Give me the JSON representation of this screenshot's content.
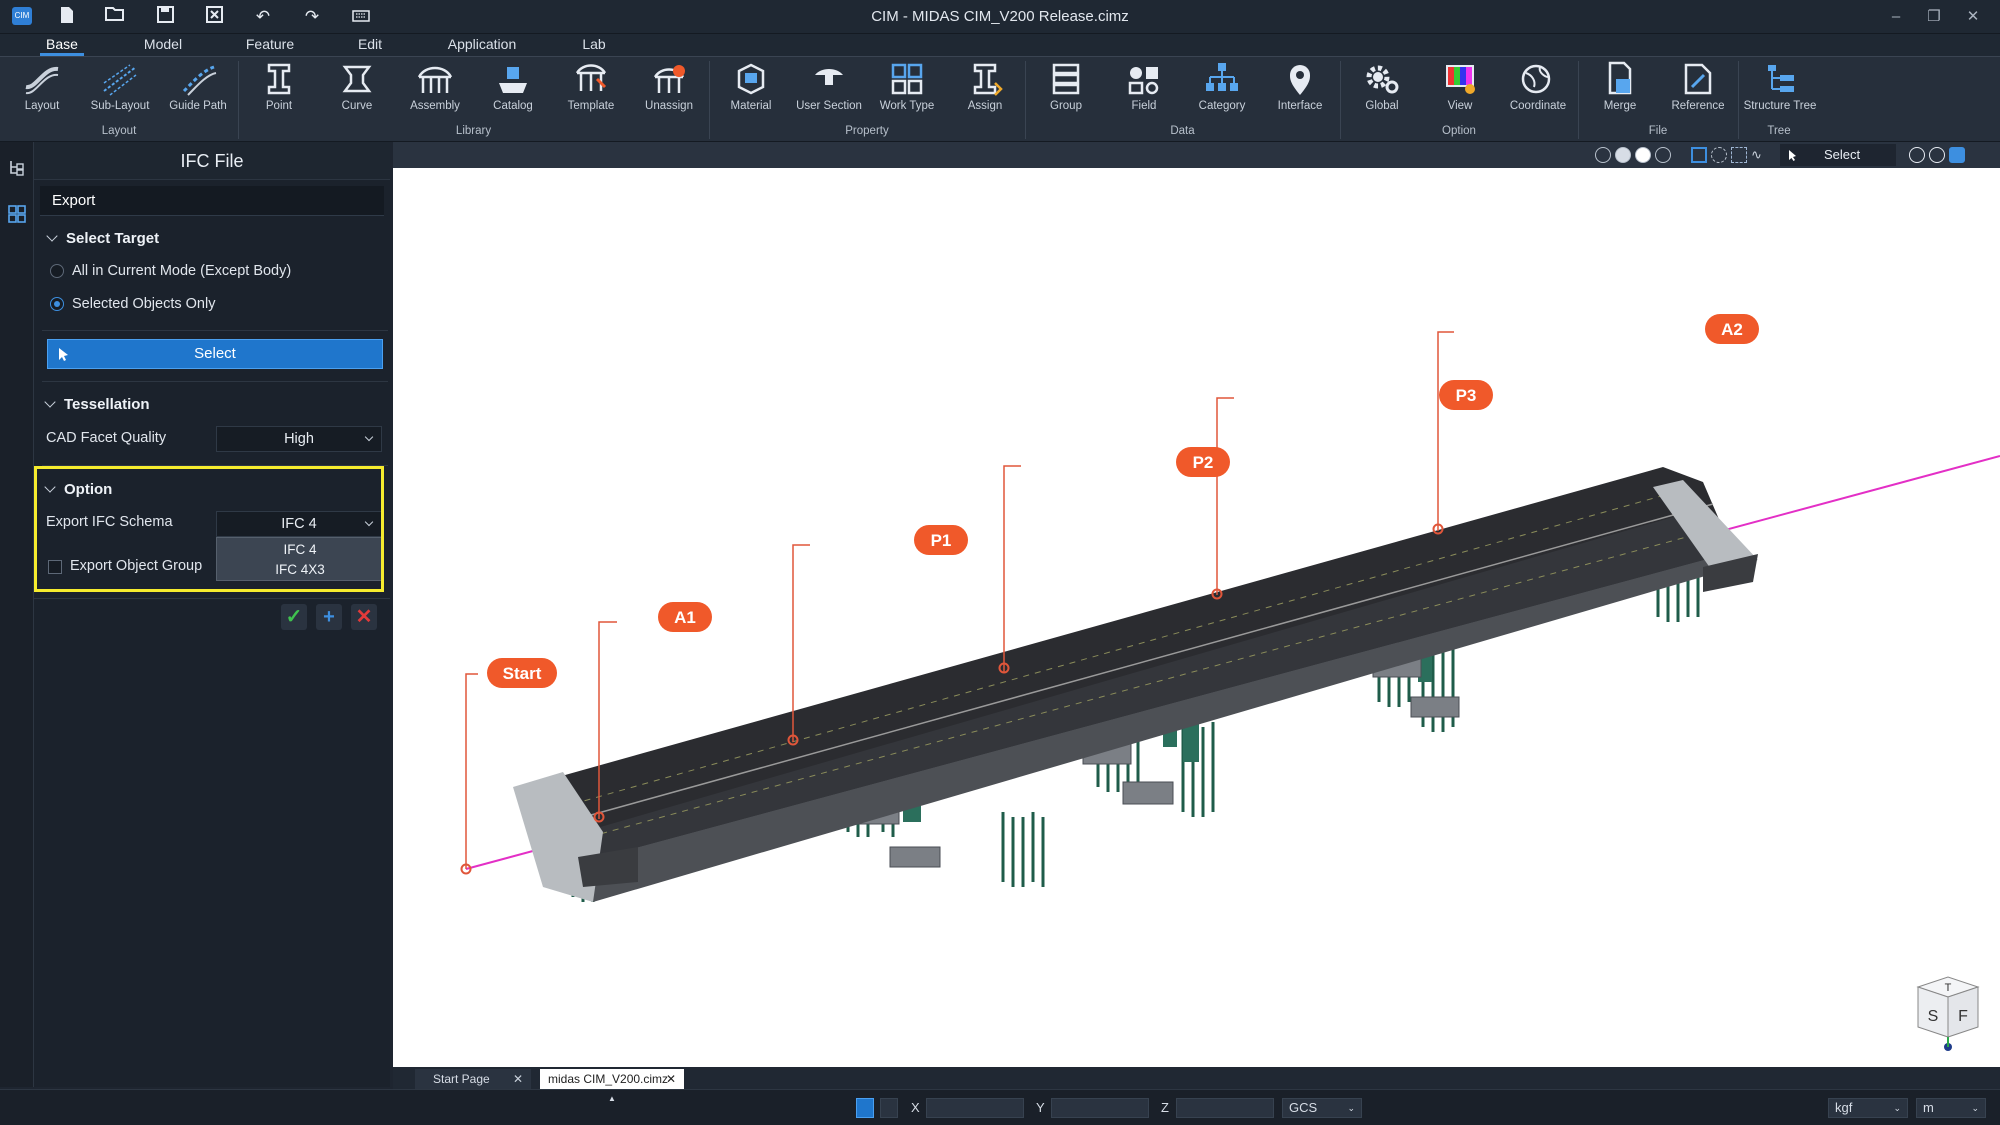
{
  "app_title": "CIM - MIDAS CIM_V200 Release.cimz",
  "quick_access": [
    "cim-logo-icon",
    "new-file-icon",
    "open-file-icon",
    "save-icon",
    "close-file-icon",
    "undo-icon",
    "redo-icon",
    "keyboard-icon"
  ],
  "tabs": [
    {
      "label": "Base",
      "active": true
    },
    {
      "label": "Model"
    },
    {
      "label": "Feature"
    },
    {
      "label": "Edit"
    },
    {
      "label": "Application"
    },
    {
      "label": "Lab"
    }
  ],
  "ribbon": {
    "buttons": [
      "Layout",
      "Sub-Layout",
      "Guide Path",
      "Point",
      "Curve",
      "Assembly",
      "Catalog",
      "Template",
      "Unassign",
      "Material",
      "User Section",
      "Work Type",
      "Assign",
      "Group",
      "Field",
      "Category",
      "Interface",
      "Global",
      "View",
      "Coordinate",
      "Merge",
      "Reference",
      "Structure Tree"
    ],
    "groups": [
      "Layout",
      "Library",
      "Property",
      "Data",
      "Option",
      "File",
      "Tree"
    ]
  },
  "panel": {
    "title": "IFC File",
    "tab": "Export",
    "select_target": {
      "header": "Select Target",
      "option_all": "All in Current Mode (Except Body)",
      "option_selected": "Selected Objects Only",
      "button": "Select"
    },
    "tessellation": {
      "header": "Tessellation",
      "facet_label": "CAD Facet Quality",
      "facet_value": "High"
    },
    "option": {
      "header": "Option",
      "schema_label": "Export IFC Schema",
      "schema_value": "IFC 4",
      "schema_options": [
        "IFC 4",
        "IFC 4X3"
      ],
      "group_label": "Export Object Group"
    }
  },
  "viewport": {
    "select_label": "Select",
    "markers": [
      "Start",
      "A1",
      "P1",
      "P2",
      "P3",
      "A2"
    ],
    "cube_faces": [
      "T",
      "S",
      "F"
    ]
  },
  "doc_tabs": [
    "Start Page",
    "midas CIM_V200.cimz"
  ],
  "status": {
    "x_label": "X",
    "y_label": "Y",
    "z_label": "Z",
    "coord_system": "GCS",
    "force_unit": "kgf",
    "length_unit": "m"
  },
  "colors": {
    "accent": "#3d8fe0",
    "marker": "#f0592a",
    "highlight": "#f6ec2e",
    "alignment": "#e32fc6"
  }
}
